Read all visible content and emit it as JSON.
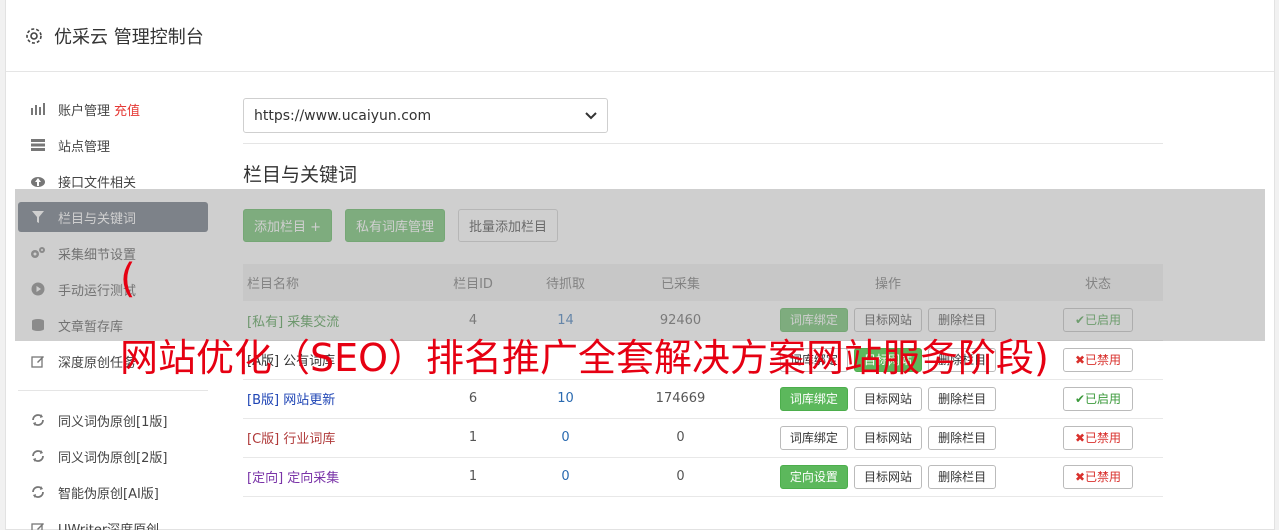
{
  "app": {
    "title": "优采云 管理控制台"
  },
  "sidebar": {
    "items": [
      {
        "label": "账户管理",
        "extra": "充值",
        "icon": "bar-chart-icon"
      },
      {
        "label": "站点管理",
        "icon": "server-icon"
      },
      {
        "label": "接口文件相关",
        "icon": "cloud-upload-icon"
      },
      {
        "label": "栏目与关键词",
        "icon": "filter-icon",
        "active": true
      },
      {
        "label": "采集细节设置",
        "icon": "gears-icon"
      },
      {
        "label": "手动运行测试",
        "icon": "play-circle-icon"
      },
      {
        "label": "文章暂存库",
        "icon": "database-icon"
      },
      {
        "label": "深度原创任务",
        "icon": "edit-icon"
      }
    ],
    "items2": [
      {
        "label": "同义词伪原创[1版]",
        "icon": "refresh-icon"
      },
      {
        "label": "同义词伪原创[2版]",
        "icon": "refresh-icon"
      },
      {
        "label": "智能伪原创[AI版]",
        "icon": "refresh-icon"
      },
      {
        "label": "UWriter深度原创",
        "icon": "edit-icon"
      }
    ]
  },
  "main": {
    "site_select": "https://www.ucaiyun.com",
    "section_title": "栏目与关键词",
    "toolbar": {
      "add_column": "添加栏目 +",
      "private_lib": "私有词库管理",
      "batch_add": "批量添加栏目"
    },
    "table": {
      "headers": [
        "栏目名称",
        "栏目ID",
        "待抓取",
        "已采集",
        "操作",
        "状态"
      ],
      "rows": [
        {
          "name": "[私有] 采集交流",
          "id": "4",
          "pending": "14",
          "collected": "92460",
          "action1": "词库绑定",
          "action2": "目标网站",
          "action3": "删除栏目",
          "status": "✔已启用"
        },
        {
          "name": "[A版] 公有词库",
          "id": "",
          "pending": "",
          "collected": "",
          "action1": "词库绑定",
          "action2": "目标网站",
          "action3": "删除栏目",
          "status": "✖已禁用"
        },
        {
          "name": "[B版] 网站更新",
          "id": "6",
          "pending": "10",
          "collected": "174669",
          "action1": "词库绑定",
          "action2": "目标网站",
          "action3": "删除栏目",
          "status": "✔已启用"
        },
        {
          "name": "[C版] 行业词库",
          "id": "1",
          "pending": "0",
          "collected": "0",
          "action1": "词库绑定",
          "action2": "目标网站",
          "action3": "删除栏目",
          "status": "✖已禁用"
        },
        {
          "name": "[定向] 定向采集",
          "id": "1",
          "pending": "0",
          "collected": "0",
          "action1": "定向设置",
          "action2": "目标网站",
          "action3": "删除栏目",
          "status": "✖已禁用"
        }
      ]
    }
  },
  "watermark": {
    "paren": "(",
    "text": "网站优化（SEO）排名推广全套解决方案网站服务阶段)"
  }
}
